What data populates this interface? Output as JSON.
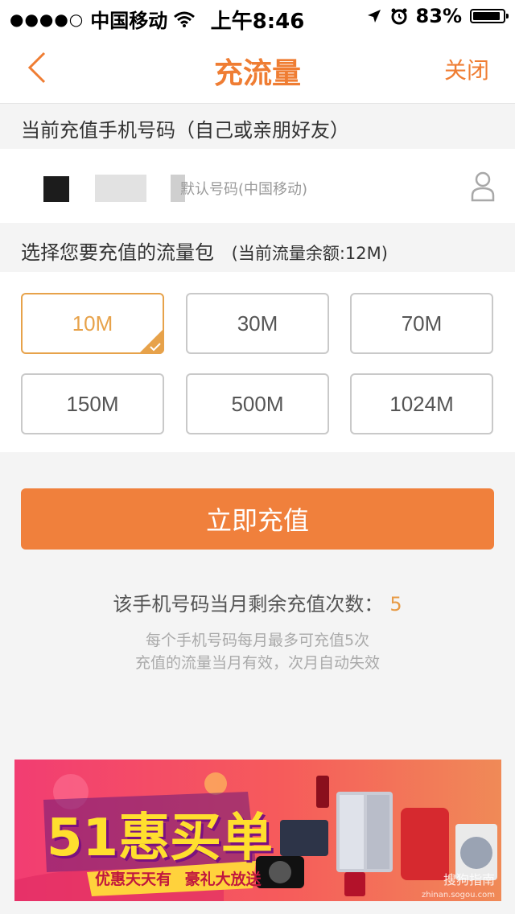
{
  "status_bar": {
    "signal_dots": "●●●●○",
    "carrier": "中国移动",
    "time": "上午8:46",
    "battery_percent": "83%",
    "battery_level": 0.83
  },
  "nav": {
    "title": "充流量",
    "close_label": "关闭"
  },
  "phone_section": {
    "label": "当前充值手机号码（自己或亲朋好友）",
    "placeholder": "默认号码(中国移动)"
  },
  "package_section": {
    "label": "选择您要充值的流量包",
    "balance": "(当前流量余额:12M)"
  },
  "packages": [
    "10M",
    "30M",
    "70M",
    "150M",
    "500M",
    "1024M"
  ],
  "selected_package": "10M",
  "recharge_button": "立即充值",
  "remaining": {
    "label": "该手机号码当月剩余充值次数：",
    "count": "5"
  },
  "notes": [
    "每个手机号码每月最多可充值5次",
    "充值的流量当月有效，次月自动失效"
  ],
  "banner": {
    "headline": "51惠买单",
    "sub_left": "优惠天天有",
    "sub_right": "豪礼大放送",
    "watermark": "搜狗指南",
    "watermark_url": "zhinan.sogou.com"
  },
  "colors": {
    "accent": "#ef7d33",
    "selected": "#e7a24a",
    "button": "#f0803c"
  }
}
